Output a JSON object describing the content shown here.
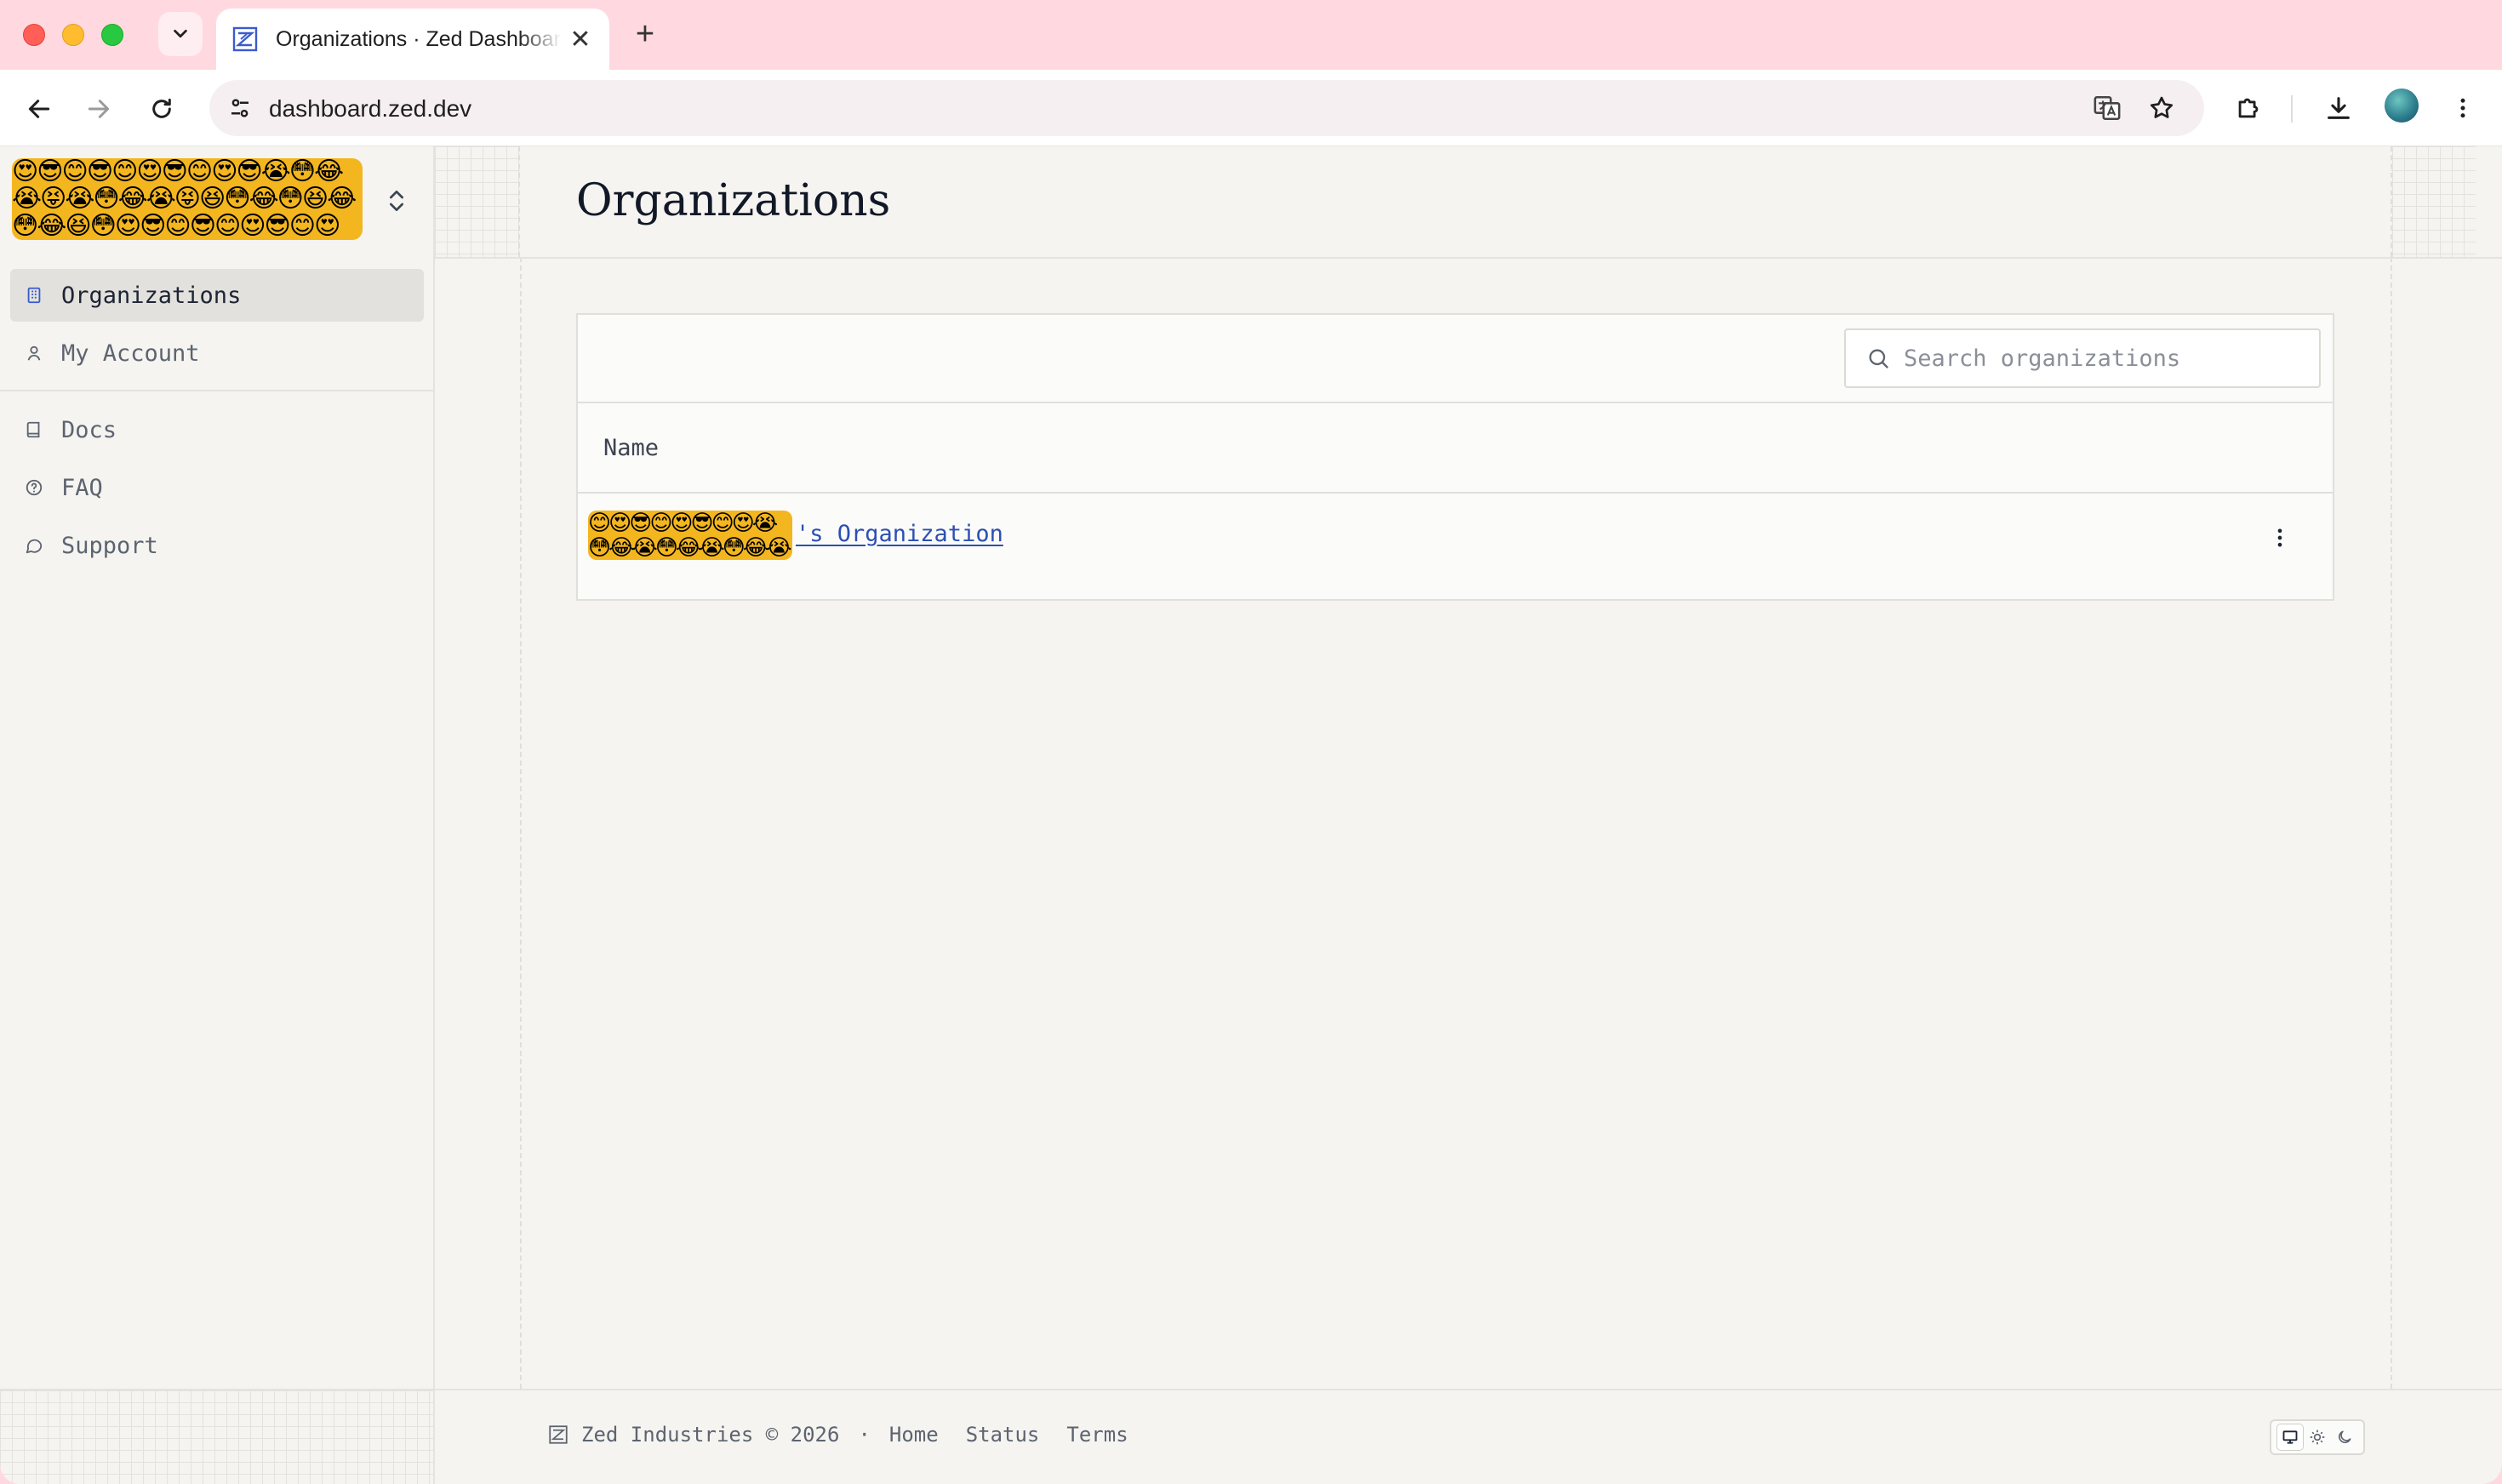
{
  "browser": {
    "tab_title": "Organizations · Zed Dashboard",
    "tab_close": "✕",
    "new_tab": "+",
    "url": "dashboard.zed.dev"
  },
  "banner_emojis": "😍😎😊😎😊😍😎😊😍😎😭😳😂😭😝😭😳😂😭😝😆😳😂😳😆😂😳😂😆😳😍😎😊😎😊😍😎😊😍😎😭😳😂😭😝😭😳😂😭😝",
  "row_emojis": "😊😍😎😊😍😎😊😍😭😳😂😭😳😂😭😳😂😭",
  "sidebar": {
    "items": [
      {
        "label": "Organizations",
        "icon": "building-icon",
        "active": true
      },
      {
        "label": "My Account",
        "icon": "user-icon",
        "active": false
      }
    ],
    "links": [
      {
        "label": "Docs",
        "icon": "book-icon"
      },
      {
        "label": "FAQ",
        "icon": "help-circle-icon"
      },
      {
        "label": "Support",
        "icon": "message-circle-icon"
      }
    ]
  },
  "main": {
    "title": "Organizations",
    "search": {
      "placeholder": "Search organizations",
      "value": ""
    },
    "table": {
      "columns": [
        "Name"
      ],
      "rows": [
        {
          "name": "'s Organization"
        }
      ]
    }
  },
  "footer": {
    "copyright": "Zed Industries © 2026",
    "separator": "·",
    "links": [
      "Home",
      "Status",
      "Terms"
    ]
  },
  "colors": {
    "accent": "#2d4fb3",
    "tabbar": "#ffd9df",
    "page_bg": "#f5f4f0",
    "active_item_bg": "#e2e1dd"
  }
}
